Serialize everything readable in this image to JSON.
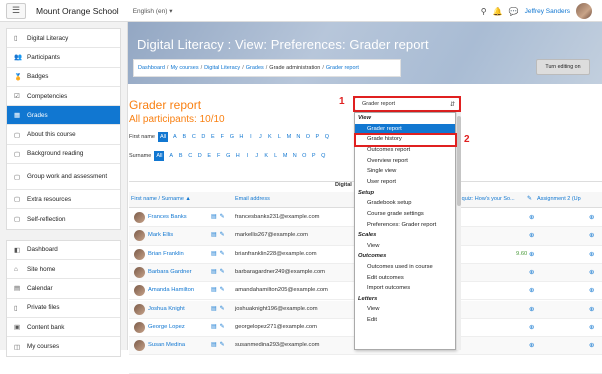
{
  "topbar": {
    "site_name": "Mount Orange School",
    "language": "English (en) ▾",
    "user_name": "Jeffrey Sanders",
    "icons": [
      "search-icon",
      "bell-icon",
      "chat-icon"
    ]
  },
  "sidebar": {
    "course_items": [
      {
        "icon": "▯",
        "label": "Digital Literacy"
      },
      {
        "icon": "👥",
        "label": "Participants"
      },
      {
        "icon": "🏅",
        "label": "Badges"
      },
      {
        "icon": "☑",
        "label": "Competencies"
      },
      {
        "icon": "▦",
        "label": "Grades",
        "active": true
      },
      {
        "icon": "▢",
        "label": "About this course"
      },
      {
        "icon": "▢",
        "label": "Background reading"
      },
      {
        "icon": "▢",
        "label": "Group work and assessment",
        "tall": true
      },
      {
        "icon": "▢",
        "label": "Extra resources"
      },
      {
        "icon": "▢",
        "label": "Self-reflection"
      }
    ],
    "site_items": [
      {
        "icon": "◧",
        "label": "Dashboard"
      },
      {
        "icon": "⌂",
        "label": "Site home"
      },
      {
        "icon": "▤",
        "label": "Calendar"
      },
      {
        "icon": "▯",
        "label": "Private files"
      },
      {
        "icon": "▣",
        "label": "Content bank"
      },
      {
        "icon": "◫",
        "label": "My courses"
      }
    ]
  },
  "header": {
    "title": "Digital Literacy : View: Preferences: Grader report",
    "breadcrumbs": [
      "Dashboard",
      "My courses",
      "Digital Literacy",
      "Grades",
      "Grade administration",
      "Grader report"
    ],
    "turn_editing": "Turn editing on"
  },
  "main": {
    "report_title": "Grader report",
    "participants": "All participants: 10/10",
    "first_name_label": "First name",
    "surname_label": "Surname",
    "all_label": "All",
    "letters": [
      "A",
      "B",
      "C",
      "D",
      "E",
      "F",
      "G",
      "H",
      "I",
      "J",
      "K",
      "L",
      "M",
      "N",
      "O",
      "P",
      "Q"
    ],
    "course_caption": "Digital",
    "col_name": "First name / Surname ▲",
    "col_email": "Email address",
    "col_quiz": "en quiz: How's your So...",
    "col_assign": "Assignment 2 (Up",
    "rows": [
      {
        "name": "Frances Banks",
        "email": "francesbanks231@example.com",
        "value": ""
      },
      {
        "name": "Mark Ellis",
        "email": "markellis267@example.com",
        "value": ""
      },
      {
        "name": "Brian Franklin",
        "email": "brianfranklin228@example.com",
        "value": "9.60"
      },
      {
        "name": "Barbara Gardner",
        "email": "barbaragardner249@example.com",
        "value": ""
      },
      {
        "name": "Amanda Hamilton",
        "email": "amandahamilton205@example.com",
        "value": ""
      },
      {
        "name": "Joshua Knight",
        "email": "joshuaknight196@example.com",
        "value": ""
      },
      {
        "name": "George Lopez",
        "email": "georgelopez271@example.com",
        "value": ""
      },
      {
        "name": "Susan Medina",
        "email": "susanmedina293@example.com",
        "value": ""
      },
      {
        "name": "",
        "email": "",
        "value": ""
      }
    ]
  },
  "dropdown": {
    "selected": "Grader report",
    "groups": [
      {
        "label": "View",
        "options": [
          "Grader report",
          "Grade history",
          "Outcomes report",
          "Overview report",
          "Single view",
          "User report"
        ]
      },
      {
        "label": "Setup",
        "options": [
          "Gradebook setup",
          "Course grade settings",
          "Preferences: Grader report"
        ]
      },
      {
        "label": "Scales",
        "options": [
          "View"
        ]
      },
      {
        "label": "Outcomes",
        "options": [
          "Outcomes used in course",
          "Edit outcomes",
          "Import outcomes"
        ]
      },
      {
        "label": "Letters",
        "options": [
          "View",
          "Edit"
        ]
      }
    ],
    "highlighted_option": "Grader report"
  },
  "annotations": {
    "one": "1",
    "two": "2"
  },
  "colors": {
    "accent": "#1177d1",
    "orange": "#f98012",
    "annotation_red": "#e02020"
  }
}
